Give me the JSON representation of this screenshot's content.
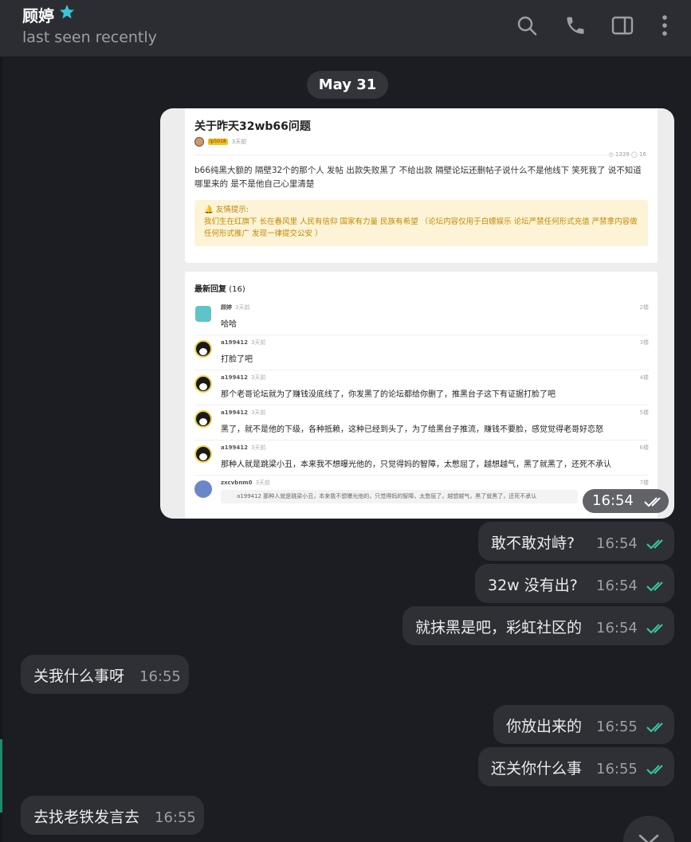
{
  "header": {
    "contact_name": "顾婷",
    "status": "last seen recently",
    "icons": [
      "search-icon",
      "phone-icon",
      "sidebar-toggle-icon",
      "more-vertical-icon"
    ]
  },
  "date_separator": "May 31",
  "photo_message": {
    "time": "16:54",
    "screenshot": {
      "title": "关于昨天32wb66问题",
      "meta_badge": "lp5018",
      "meta_time": "3天前",
      "stats": "◎ 1339  ◯ 16",
      "body": "b66纯黑大额的 隔壁32个的那个人 发帖 出款失败黑了 不给出款 隔壁论坛还删帖子说什么不是他线下 笑死我了 说不知道哪里来的 是不是他自己心里清楚",
      "notice_title": "🔔 友情提示:",
      "notice_body": "我们生在红旗下 长在春风里 人民有信仰 国家有力量 民族有希望 （论坛内容仅用于白嫖娱乐 论坛严禁任何形式充值 严禁拿内容做任何形式推广 发现一律提交公安 ）",
      "replies_label": "最新回复",
      "replies_count": "(16)",
      "replies": [
        {
          "user": "顾婷",
          "time": "3天前",
          "floor": "2楼",
          "text": "哈哈"
        },
        {
          "user": "a199412",
          "time": "3天前",
          "floor": "3楼",
          "text": "打脸了吧"
        },
        {
          "user": "a199412",
          "time": "3天前",
          "floor": "4楼",
          "text": "那个老哥论坛就为了赚钱没底线了，你发黑了的论坛都给你删了，推黑台子这下有证据打脸了吧"
        },
        {
          "user": "a199412",
          "time": "3天前",
          "floor": "5楼",
          "text": "黑了，就不是他的下级，各种抵赖，这种已经到头了，为了给黑台子推流，赚钱不要脸，感觉觉得老哥好恋怒"
        },
        {
          "user": "a199412",
          "time": "3天前",
          "floor": "6楼",
          "text": "那种人就是跳梁小丑，本来我不想曝光他的，只觉得妈的智障，太憋屈了，越想越气，黑了就黑了，还死不承认"
        },
        {
          "user": "zxcvbnm0",
          "time": "3天前",
          "floor": "7楼",
          "quote": "a199412   那种人就是跳梁小丑，本来我不想曝光他的，只觉得妈的智障，太憋屈了，越想越气，黑了就黑了，还死不承认"
        }
      ]
    }
  },
  "messages": [
    {
      "side": "out",
      "text": "敢不敢对峙?",
      "time": "16:54"
    },
    {
      "side": "out",
      "text": "32w 没有出?",
      "time": "16:54"
    },
    {
      "side": "out",
      "text": "就抹黑是吧，彩虹社区的",
      "time": "16:54"
    },
    {
      "side": "in",
      "text": "关我什么事呀",
      "time": "16:55"
    },
    {
      "side": "out",
      "text": "你放出来的",
      "time": "16:55"
    },
    {
      "side": "out",
      "text": "还关你什么事",
      "time": "16:55"
    },
    {
      "side": "in",
      "text": "去找老铁发言去",
      "time": "16:55"
    }
  ],
  "colors": {
    "accent": "#38c7a6",
    "bubble": "#2e3036",
    "background": "#1c1d22"
  }
}
